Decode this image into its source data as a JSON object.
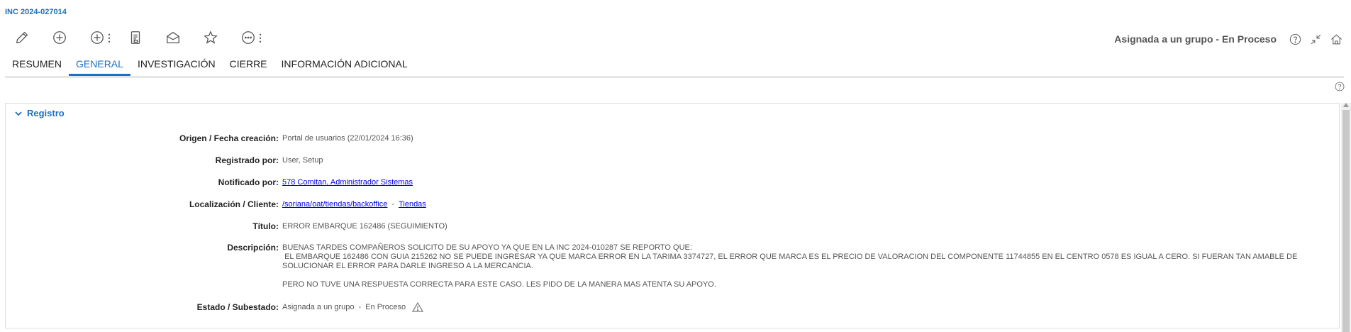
{
  "header": {
    "incident_id": "INC 2024-027014",
    "status": "Asignada a un grupo - En Proceso"
  },
  "toolbar": {
    "icons": [
      "pencil-icon",
      "add-circle-icon",
      "add-circle-more-icon",
      "document-icon",
      "envelope-open-icon",
      "star-icon",
      "ellipsis-circle-icon"
    ]
  },
  "tabs": [
    {
      "label": "RESUMEN",
      "active": false
    },
    {
      "label": "GENERAL",
      "active": true
    },
    {
      "label": "INVESTIGACIÓN",
      "active": false
    },
    {
      "label": "CIERRE",
      "active": false
    },
    {
      "label": "INFORMACIÓN ADICIONAL",
      "active": false
    }
  ],
  "section": {
    "title": "Registro",
    "fields": {
      "origen": {
        "label": "Origen / Fecha creación:",
        "value": "Portal de usuarios  (22/01/2024 16:36)"
      },
      "registrado": {
        "label": "Registrado por:",
        "value": "User, Setup"
      },
      "notificado": {
        "label": "Notificado por:",
        "value": "578 Comitan, Administrador Sistemas"
      },
      "localizacion": {
        "label": "Localización / Cliente:",
        "path": "/soriana/oat/tiendas/backoffice",
        "separator": "-",
        "client": "Tiendas"
      },
      "titulo": {
        "label": "Título:",
        "value": "ERROR EMBARQUE 162486 (SEGUIMIENTO)"
      },
      "descripcion": {
        "label": "Descripción:",
        "line1": "BUENAS TARDES COMPAÑEROS SOLICITO DE SU APOYO YA QUE EN LA  INC 2024-010287 SE REPORTO QUE:",
        "line2": " EL EMBARQUE 162486 CON GUIA 215262 NO SE PUEDE INGRESAR YA QUE MARCA ERROR EN LA TARIMA 3374727, EL ERROR QUE MARCA ES EL PRECIO DE VALORACION DEL COMPONENTE 11744855 EN EL CENTRO 0578 ES IGUAL A CERO. SI FUERAN TAN AMABLE DE SOLUCIONAR EL ERROR PARA DARLE INGRESO A LA MERCANCIA.",
        "line3": "PERO NO TUVE UNA RESPUESTA CORRECTA PARA ESTE CASO. LES PIDO DE LA MANERA MAS ATENTA SU APOYO."
      },
      "estado": {
        "label": "Estado / Subestado:",
        "state": "Asignada a un grupo",
        "separator": "-",
        "substate": "En Proceso"
      }
    }
  },
  "colors": {
    "accent": "#1f6fbf",
    "link": "#0000ee"
  }
}
